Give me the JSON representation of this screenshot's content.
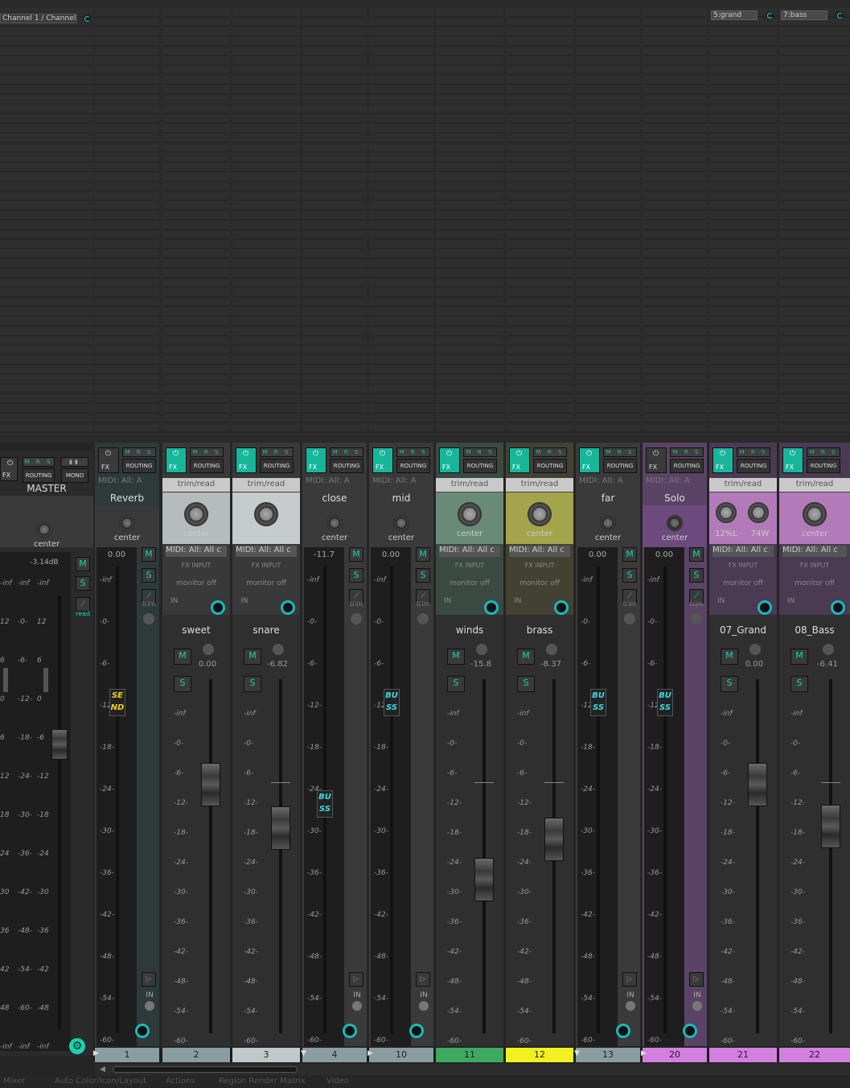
{
  "fx_slots": {
    "master_channel_label": "Channel 1 / Channel 2",
    "grand": "5:grand",
    "bass": "7:bass"
  },
  "master": {
    "name": "MASTER",
    "mono_label": "MONO",
    "routing_label": "ROUTING",
    "fx_label": "FX",
    "pan": "center",
    "peak": "-3.14dB",
    "m": "M",
    "s": "S",
    "mode": "read",
    "scale_left": [
      "-inf",
      "12",
      "6",
      "0",
      "6",
      "12",
      "18",
      "24",
      "30",
      "36",
      "42",
      "48",
      "-inf"
    ],
    "scale_mid_l": [
      "-inf",
      "-0-",
      "-6-",
      "-12-",
      "-18-",
      "-24-",
      "-30-",
      "-36-",
      "-42-",
      "-48-",
      "-54-",
      "-60-",
      "-inf"
    ],
    "scale_mid_r": [
      "-inf",
      "12",
      "6",
      "0",
      "-6",
      "-12",
      "-18",
      "-24",
      "-30",
      "-36",
      "-42",
      "-48",
      "-inf"
    ]
  },
  "common": {
    "fx": "FX",
    "routing": "ROUTING",
    "mrs": "M R S",
    "midi": "MIDI: All: A",
    "midi2": "MIDI: All: All c",
    "trim": "trim/read",
    "center": "center",
    "fx_input": "FX INPUT",
    "monitor": "monitor off",
    "in": "IN",
    "m": "M",
    "s": "S",
    "trim_word": "trim"
  },
  "strips": [
    {
      "name": "Reverb",
      "num": "1",
      "val": "0.00",
      "bus": "SE ND",
      "color": "#2e3a3a",
      "num_color": "#8a9da3"
    },
    {
      "name": "sweet",
      "num": "2",
      "val": "0.00",
      "color": "#393939",
      "num_color": "#8a9da3"
    },
    {
      "name": "snare",
      "num": "3",
      "val": "-6.82",
      "color": "#393939",
      "num_color": "#bfc9c9"
    },
    {
      "name": "close",
      "num": "4",
      "val": "-11.7",
      "bus": "BU SS",
      "color": "#3a3a3a",
      "num_color": "#8a9da3"
    },
    {
      "name": "mid",
      "num": "10",
      "val": "0.00",
      "bus": "BU SS",
      "color": "#3a3a3a",
      "num_color": "#8a9da3"
    },
    {
      "name": "winds",
      "num": "11",
      "val": "-15.8",
      "color": "#3a4a42",
      "num_color": "#3da860"
    },
    {
      "name": "brass",
      "num": "12",
      "val": "-8.37",
      "color": "#434232",
      "num_color": "#f2f020"
    },
    {
      "name": "far",
      "num": "13",
      "val": "0.00",
      "bus": "BU SS",
      "color": "#3a3a3a",
      "num_color": "#8a9da3"
    },
    {
      "name": "Solo",
      "num": "20",
      "val": "0.00",
      "bus": "BU SS",
      "color": "#5b4366",
      "num_color": "#d37fe0"
    },
    {
      "name": "07_Grand",
      "num": "21",
      "val": "0.00",
      "pan_l": "12%L",
      "pan_r": "74W",
      "color": "#4a3a52",
      "num_color": "#d37fe0"
    },
    {
      "name": "08_Bass",
      "num": "22",
      "val": "-6.41",
      "color": "#4a3a52",
      "num_color": "#d37fe0"
    }
  ],
  "scale_short": [
    "-inf",
    "-0-",
    "-6-",
    "-12-",
    "-18-",
    "-24-",
    "-30-",
    "-36-",
    "-42-",
    "-48-",
    "-54-",
    "-60-"
  ],
  "scale_tall": [
    "-inf",
    "-0-",
    "-6-",
    "-12-",
    "-18-",
    "-24-",
    "-30-",
    "-36-",
    "-42-",
    "-48-",
    "-54-",
    "-60-"
  ],
  "bottom_tabs": [
    "Mixer",
    "Auto Color/Icon/Layout",
    "Actions",
    "Region Render Matrix",
    "Video"
  ]
}
